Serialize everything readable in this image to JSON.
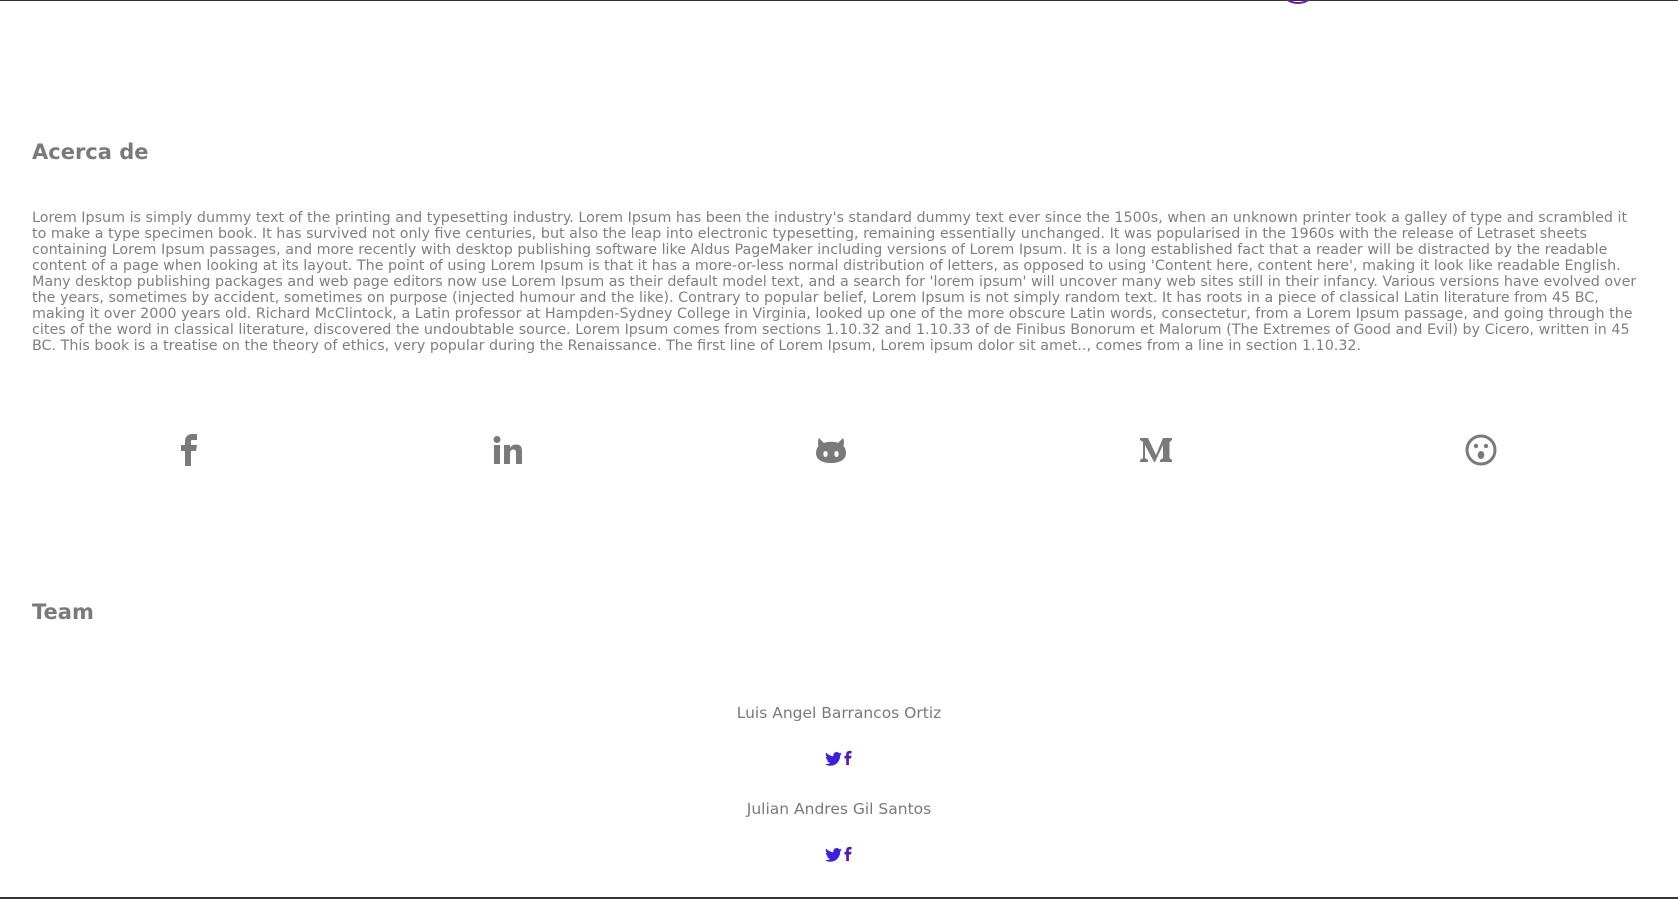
{
  "about": {
    "title": "Acerca de",
    "text": "Lorem Ipsum is simply dummy text of the printing and typesetting industry. Lorem Ipsum has been the industry's standard dummy text ever since the 1500s, when an unknown printer took a galley of type and scrambled it to make a type specimen book. It has survived not only five centuries, but also the leap into electronic typesetting, remaining essentially unchanged. It was popularised in the 1960s with the release of Letraset sheets containing Lorem Ipsum passages, and more recently with desktop publishing software like Aldus PageMaker including versions of Lorem Ipsum. It is a long established fact that a reader will be distracted by the readable content of a page when looking at its layout. The point of using Lorem Ipsum is that it has a more-or-less normal distribution of letters, as opposed to using 'Content here, content here', making it look like readable English. Many desktop publishing packages and web page editors now use Lorem Ipsum as their default model text, and a search for 'lorem ipsum' will uncover many web sites still in their infancy. Various versions have evolved over the years, sometimes by accident, sometimes on purpose (injected humour and the like). Contrary to popular belief, Lorem Ipsum is not simply random text. It has roots in a piece of classical Latin literature from 45 BC, making it over 2000 years old. Richard McClintock, a Latin professor at Hampden-Sydney College in Virginia, looked up one of the more obscure Latin words, consectetur, from a Lorem Ipsum passage, and going through the cites of the word in classical literature, discovered the undoubtable source. Lorem Ipsum comes from sections 1.10.32 and 1.10.33 of de Finibus Bonorum et Malorum (The Extremes of Good and Evil) by Cicero, written in 45 BC. This book is a treatise on the theory of ethics, very popular during the Renaissance. The first line of Lorem Ipsum, Lorem ipsum dolor sit amet.., comes from a line in section 1.10.32."
  },
  "social": [
    {
      "icon": "facebook-icon"
    },
    {
      "icon": "linkedin-icon"
    },
    {
      "icon": "github-icon"
    },
    {
      "icon": "medium-icon"
    },
    {
      "icon": "surprised-face-icon"
    }
  ],
  "team": {
    "title": "Team",
    "members": [
      {
        "name": "Luis Angel Barrancos Ortiz",
        "links": [
          "twitter-icon",
          "facebook-icon"
        ]
      },
      {
        "name": "Julian Andres Gil Santos",
        "links": [
          "twitter-icon",
          "facebook-icon"
        ]
      }
    ]
  },
  "colors": {
    "text": "#7a7a7a",
    "accent_twitter": "#3d1fe0",
    "accent_facebook": "#5b16a8",
    "border": "#333333"
  }
}
